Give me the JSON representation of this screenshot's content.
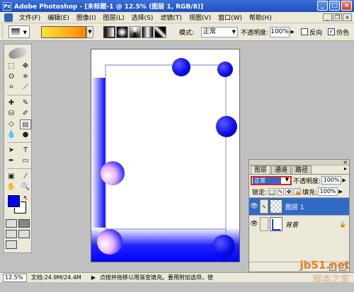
{
  "window": {
    "title": "Adobe Photoshop - [未标题-1 @ 12.5% (图层 1, RGB/8)]",
    "minimize": "_",
    "maximize": "□",
    "close": "×"
  },
  "menu": {
    "items": [
      "文件(F)",
      "编辑(E)",
      "图像(I)",
      "图层(L)",
      "选择(S)",
      "滤镜(T)",
      "视图(V)",
      "窗口(W)",
      "帮助(H)"
    ]
  },
  "options": {
    "mode_label": "模式:",
    "mode_value": "正常",
    "opacity_label": "不透明度:",
    "opacity_value": "100%",
    "reverse_label": "反向",
    "dither_label": "仿色",
    "reverse_checked": false,
    "dither_checked": true,
    "gradient_colors": [
      "#ffe23a",
      "#ff8800"
    ]
  },
  "toolbox": {
    "foreground_color": "#0000ff",
    "background_color": "#ffffff"
  },
  "layers_panel": {
    "tabs": [
      "图层",
      "通道",
      "路径"
    ],
    "blend_mode": "正常",
    "opacity_label": "不透明度:",
    "opacity_value": "100%",
    "lock_label": "锁定:",
    "fill_label": "填充:",
    "fill_value": "100%",
    "layers": [
      {
        "name": "图层 1",
        "selected": true
      },
      {
        "name": "背景",
        "selected": false,
        "locked": true
      }
    ]
  },
  "status": {
    "zoom": "12.5%",
    "doc_info": "文档:24.9M/24.4M",
    "hint": "点按并拖移以用渐变填充。要用附加选项，使"
  },
  "watermark": {
    "url": "jb51.net",
    "text": "脚本之家"
  }
}
